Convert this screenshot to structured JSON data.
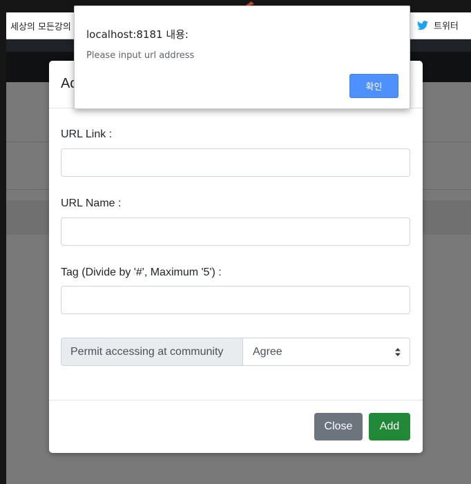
{
  "bookmarks": {
    "left_label": "세상의 모든강의",
    "right_label": "트위터"
  },
  "modal": {
    "title": "Ad",
    "url_link_label": "URL Link :",
    "url_link_value": "",
    "url_name_label": "URL Name :",
    "url_name_value": "",
    "tag_label": "Tag (Divide by '#', Maximum '5') :",
    "tag_value": "",
    "permit_label": "Permit accessing at community",
    "permit_selected": "Agree",
    "close_label": "Close",
    "add_label": "Add"
  },
  "alert": {
    "title": "localhost:8181 내용:",
    "message": "Please input url address",
    "ok_label": "확인"
  },
  "colors": {
    "close_button": "#6c757d",
    "add_button": "#218838",
    "alert_ok": "#4d90fe",
    "twitter": "#1da1f2"
  },
  "icons": {
    "bookmark_right": "twitter-bird-icon",
    "select_caret": "updown-caret-icon"
  }
}
